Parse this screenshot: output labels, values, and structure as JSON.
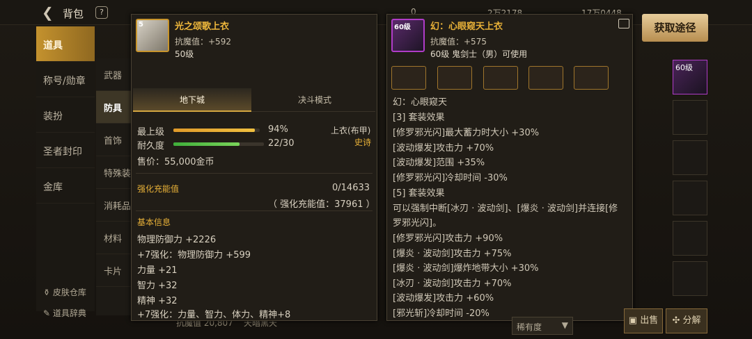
{
  "header": {
    "title": "背包",
    "help": "?",
    "currency1": "0",
    "currency2": "2万2178",
    "currency3": "17万0448"
  },
  "sidebar": {
    "items": [
      {
        "label": "道具"
      },
      {
        "label": "称号/勋章"
      },
      {
        "label": "装扮"
      },
      {
        "label": "圣者封印"
      },
      {
        "label": "金库"
      }
    ]
  },
  "subnav": {
    "items": [
      {
        "label": "武器"
      },
      {
        "label": "防具"
      },
      {
        "label": "首饰"
      },
      {
        "label": "特殊装"
      },
      {
        "label": "消耗品"
      },
      {
        "label": "材料"
      },
      {
        "label": "卡片"
      }
    ]
  },
  "bottom_links": {
    "skin": "皮肤仓库",
    "dict": "道具辞典"
  },
  "item1": {
    "name": "光之颂歌上衣",
    "level_badge": "5",
    "magic_resist": "抗魔值：+592",
    "level": "50级",
    "tab_dungeon": "地下城",
    "tab_duel": "决斗模式",
    "max_label": "最上级",
    "max_pct": "94%",
    "max_value": 0.94,
    "dur_label": "耐久度",
    "dur_value": "22/30",
    "dur_fraction": 0.7333,
    "type": "上衣(布甲)",
    "rarity": "史诗",
    "price": "售价：55,000金币",
    "charge_label": "强化充能值",
    "charge_value": "0/14633",
    "charge_total": "（ 强化充能值：37961 ）",
    "basic_info": "基本信息",
    "stats": [
      {
        "text": "物理防御力 +2226",
        "color": "normal"
      },
      {
        "text": "+7强化：物理防御力 +599",
        "color": "cyan"
      },
      {
        "text": "力量 +21",
        "color": "normal"
      },
      {
        "text": "智力 +32",
        "color": "normal"
      },
      {
        "text": "精神 +32",
        "color": "normal"
      },
      {
        "text": "+7强化：力量、智力、体力、精神+8",
        "color": "cyan"
      }
    ]
  },
  "item2": {
    "name": "幻：心眼窥天上衣",
    "level_badge": "60级",
    "magic_resist": "抗魔值：+575",
    "requirement": "60级 鬼剑士（男）可使用",
    "set_name": "幻：心眼窥天",
    "lines": [
      "[3] 套装效果",
      "[修罗邪光闪]最大蓄力时大小 +30%",
      "[波动爆发]攻击力 +70%",
      "[波动爆发]范围 +35%",
      "[修罗邪光闪]冷却时间 -30%",
      "[5] 套装效果",
      "可以强制中断[冰刃 · 波动剑]、[爆炎 · 波动剑]并连接[修",
      "罗邪光闪]。",
      "[修罗邪光闪]攻击力 +90%",
      "[爆炎 · 波动剑]攻击力 +75%",
      "[爆炎 · 波动剑]爆炸地带大小 +30%",
      "[冰刃 · 波动剑]攻击力 +70%",
      "[波动爆发]攻击力 +60%",
      "[邪光斩]冷却时间 -20%"
    ]
  },
  "actions": {
    "get_source": "获取途径",
    "sell": "出售",
    "decompose": "分解",
    "sort": "稀有度",
    "right_slot_level": "60级"
  },
  "background": {
    "resist_text": "抗魔值 20,807",
    "zone": "天暗黑天"
  }
}
